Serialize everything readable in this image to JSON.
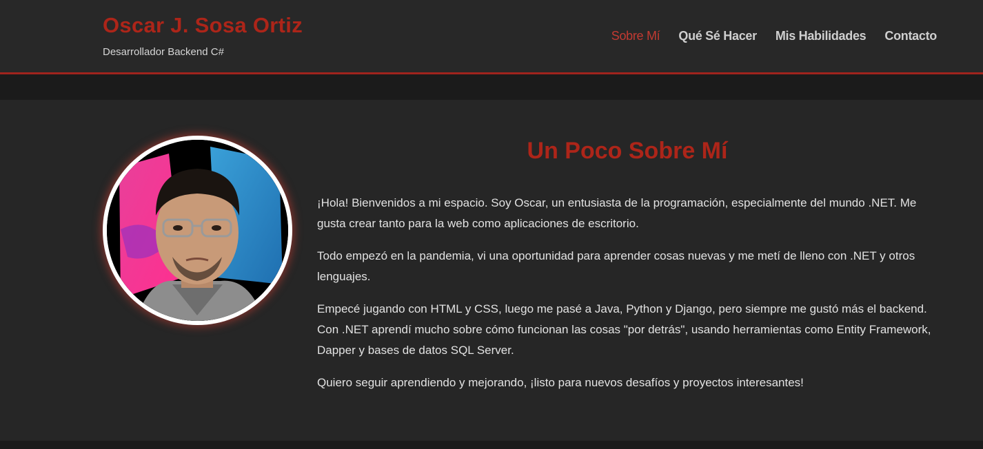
{
  "header": {
    "brand_name": "Oscar J. Sosa Ortiz",
    "tagline": "Desarrollador Backend C#"
  },
  "nav": {
    "items": [
      "Sobre Mí",
      "Qué Sé Hacer",
      "Mis Habilidades",
      "Contacto"
    ],
    "active": "Sobre Mí"
  },
  "about": {
    "title": "Un Poco Sobre Mí",
    "paragraphs": [
      "¡Hola! Bienvenidos a mi espacio. Soy Oscar, un entusiasta de la programación, especialmente del mundo .NET. Me gusta crear tanto para la web como aplicaciones de escritorio.",
      "Todo empezó en la pandemia, vi una oportunidad para aprender cosas nuevas y me metí de lleno con .NET y otros lenguajes.",
      "Empecé jugando con HTML y CSS, luego me pasé a Java, Python y Django, pero siempre me gustó más el backend. Con .NET aprendí mucho sobre cómo funcionan las cosas \"por detrás\", usando herramientas como Entity Framework, Dapper y bases de datos SQL Server.",
      "Quiero seguir aprendiendo y mejorando, ¡listo para nuevos desafíos y proyectos interesantes!"
    ]
  },
  "colors": {
    "accent": "#ad2519",
    "header_bg": "#282828",
    "section_bg": "#262626",
    "page_bg": "#1b1b1b"
  }
}
